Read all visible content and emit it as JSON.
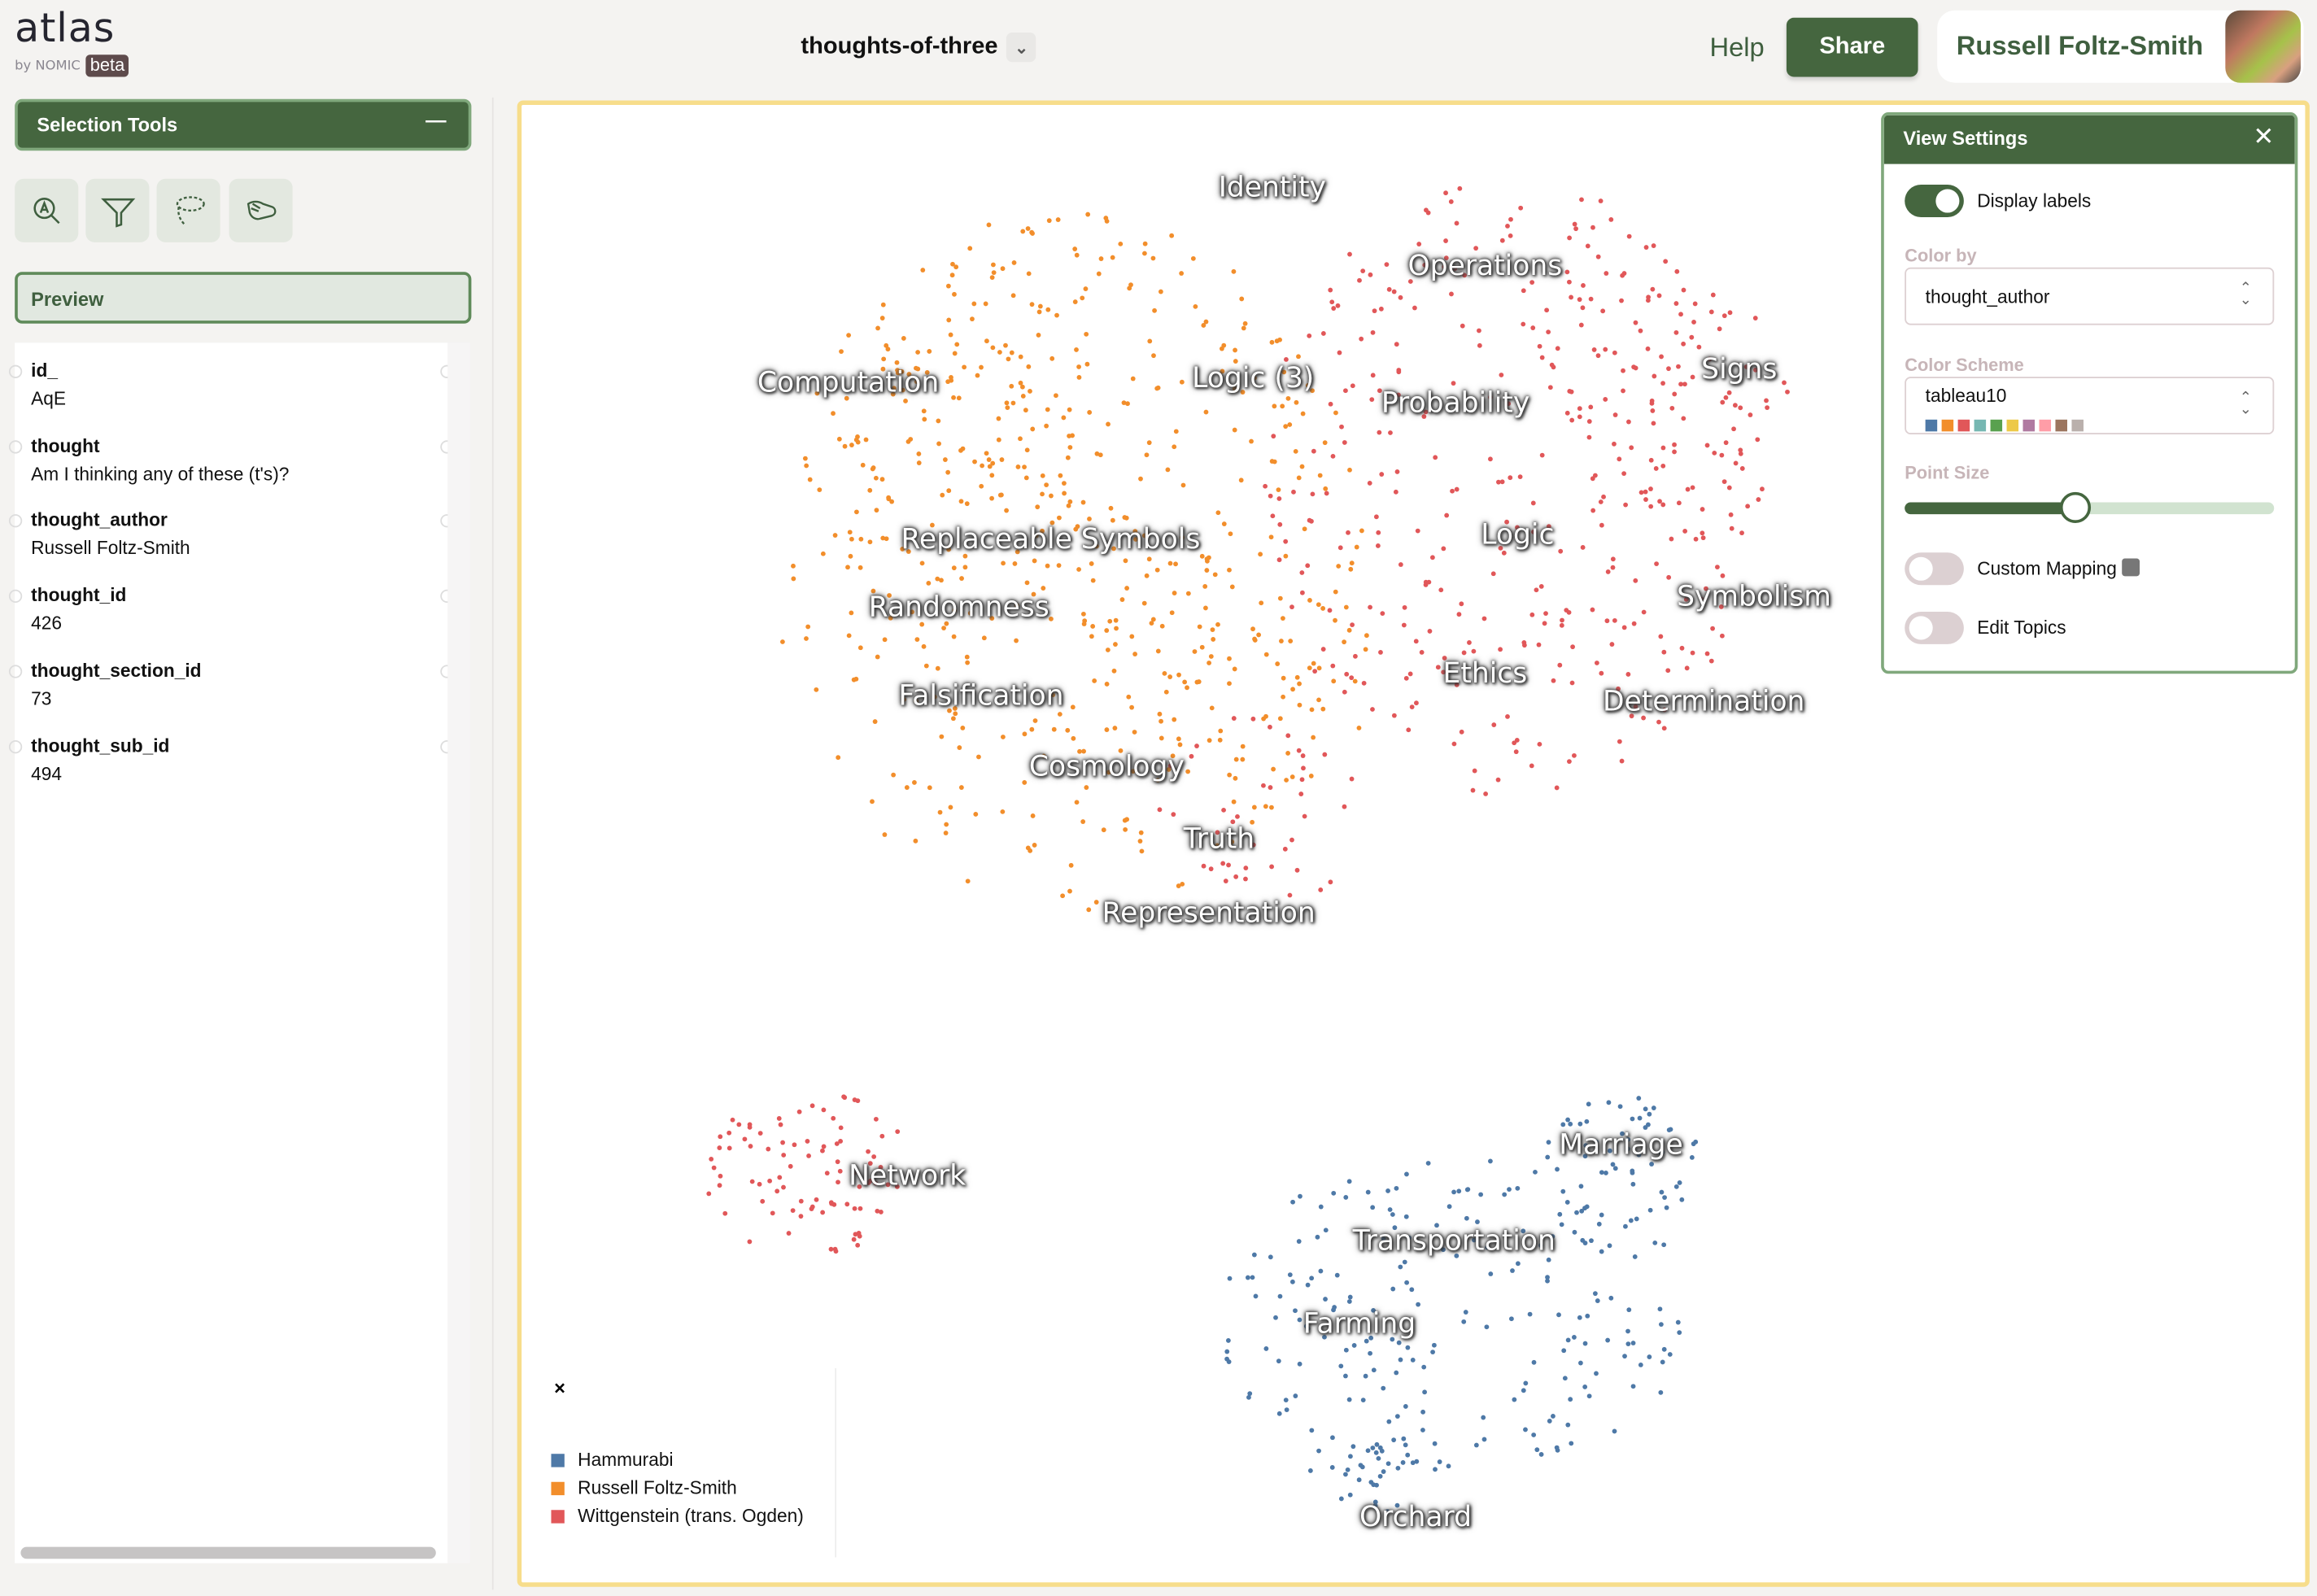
{
  "header": {
    "logo": "atlas",
    "logo_by": "by NOMIC",
    "beta": "beta",
    "project_name": "thoughts-of-three",
    "help": "Help",
    "share": "Share",
    "user_name": "Russell Foltz-Smith"
  },
  "sidebar": {
    "selection_tools": "Selection Tools",
    "minimize_icon": "minus-icon",
    "tools": [
      {
        "name": "search-text-tool",
        "icon": "magnifier-a-icon"
      },
      {
        "name": "filter-tool",
        "icon": "funnel-icon"
      },
      {
        "name": "lasso-tool",
        "icon": "lasso-icon"
      },
      {
        "name": "pan-tool",
        "icon": "hand-icon"
      }
    ],
    "preview": "Preview",
    "fields": [
      {
        "key": "id_",
        "value": "AqE"
      },
      {
        "key": "thought",
        "value": "Am I thinking any of these (t's)?"
      },
      {
        "key": "thought_author",
        "value": "Russell Foltz-Smith"
      },
      {
        "key": "thought_id",
        "value": "426"
      },
      {
        "key": "thought_section_id",
        "value": "73"
      },
      {
        "key": "thought_sub_id",
        "value": "494"
      }
    ]
  },
  "map": {
    "topics": [
      "Identity",
      "Operations",
      "Computation",
      "Logic (3)",
      "Probability",
      "Signs",
      "Replaceable Symbols",
      "Logic",
      "Randomness",
      "Symbolism",
      "Falsification",
      "Ethics",
      "Determination",
      "Cosmology",
      "Truth",
      "Representation",
      "Network",
      "Marriage",
      "Transportation",
      "Farming",
      "Orchard"
    ],
    "legend": {
      "close": "×",
      "items": [
        {
          "label": "Hammurabi",
          "color": "#4e79a7"
        },
        {
          "label": "Russell Foltz-Smith",
          "color": "#f28e2b"
        },
        {
          "label": "Wittgenstein (trans. Ogden)",
          "color": "#e15759"
        }
      ]
    }
  },
  "view_settings": {
    "title": "View Settings",
    "display_labels": "Display labels",
    "display_labels_on": true,
    "color_by_label": "Color by",
    "color_by_value": "thought_author",
    "color_scheme_label": "Color Scheme",
    "color_scheme_value": "tableau10",
    "scheme_colors": [
      "#4e79a7",
      "#f28e2b",
      "#e15759",
      "#76b7b2",
      "#59a14f",
      "#edc948",
      "#b07aa1",
      "#ff9da7",
      "#9c755f",
      "#bab0ac"
    ],
    "point_size_label": "Point Size",
    "point_size_fraction": 0.46,
    "custom_mapping": "Custom Mapping",
    "custom_mapping_on": false,
    "edit_topics": "Edit Topics",
    "edit_topics_on": false,
    "accent": "#45663f"
  }
}
